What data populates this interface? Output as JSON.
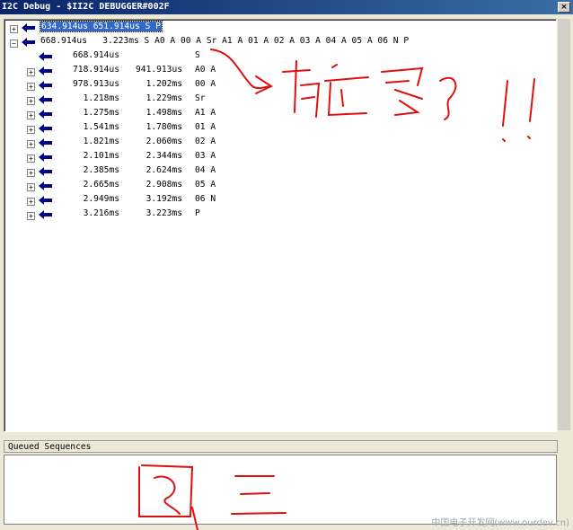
{
  "window": {
    "title": "I2C Debug - $II2C DEBUGGER#002F",
    "close_label": "×"
  },
  "tree": {
    "root1": {
      "expander": "+",
      "text": "634.914us 651.914us S P"
    },
    "root2": {
      "expander": "−",
      "text": "668.914us   3.223ms S A0 A 00 A Sr A1 A 01 A 02 A 03 A 04 A 05 A 06 N P"
    },
    "children": [
      {
        "expander": "",
        "c1": "668.914us",
        "c2": "",
        "c3": "S"
      },
      {
        "expander": "+",
        "c1": "718.914us",
        "c2": "941.913us",
        "c3": "A0 A"
      },
      {
        "expander": "+",
        "c1": "978.913us",
        "c2": "1.202ms",
        "c3": "00 A"
      },
      {
        "expander": "+",
        "c1": "1.218ms",
        "c2": "1.229ms",
        "c3": "Sr"
      },
      {
        "expander": "+",
        "c1": "1.275ms",
        "c2": "1.498ms",
        "c3": "A1 A"
      },
      {
        "expander": "+",
        "c1": "1.541ms",
        "c2": "1.780ms",
        "c3": "01 A"
      },
      {
        "expander": "+",
        "c1": "1.821ms",
        "c2": "2.060ms",
        "c3": "02 A"
      },
      {
        "expander": "+",
        "c1": "2.101ms",
        "c2": "2.344ms",
        "c3": "03 A"
      },
      {
        "expander": "+",
        "c1": "2.385ms",
        "c2": "2.624ms",
        "c3": "04 A"
      },
      {
        "expander": "+",
        "c1": "2.665ms",
        "c2": "2.908ms",
        "c3": "05 A"
      },
      {
        "expander": "+",
        "c1": "2.949ms",
        "c2": "3.192ms",
        "c3": "06 N"
      },
      {
        "expander": "+",
        "c1": "3.216ms",
        "c2": "3.223ms",
        "c3": "P"
      }
    ]
  },
  "queued": {
    "header": "Queued Sequences"
  },
  "watermark": "中国电子开发网(www.ourdev.cn)",
  "colors": {
    "arrow": "#00008b",
    "selection": "#316ac5",
    "annotation": "#e01010"
  }
}
